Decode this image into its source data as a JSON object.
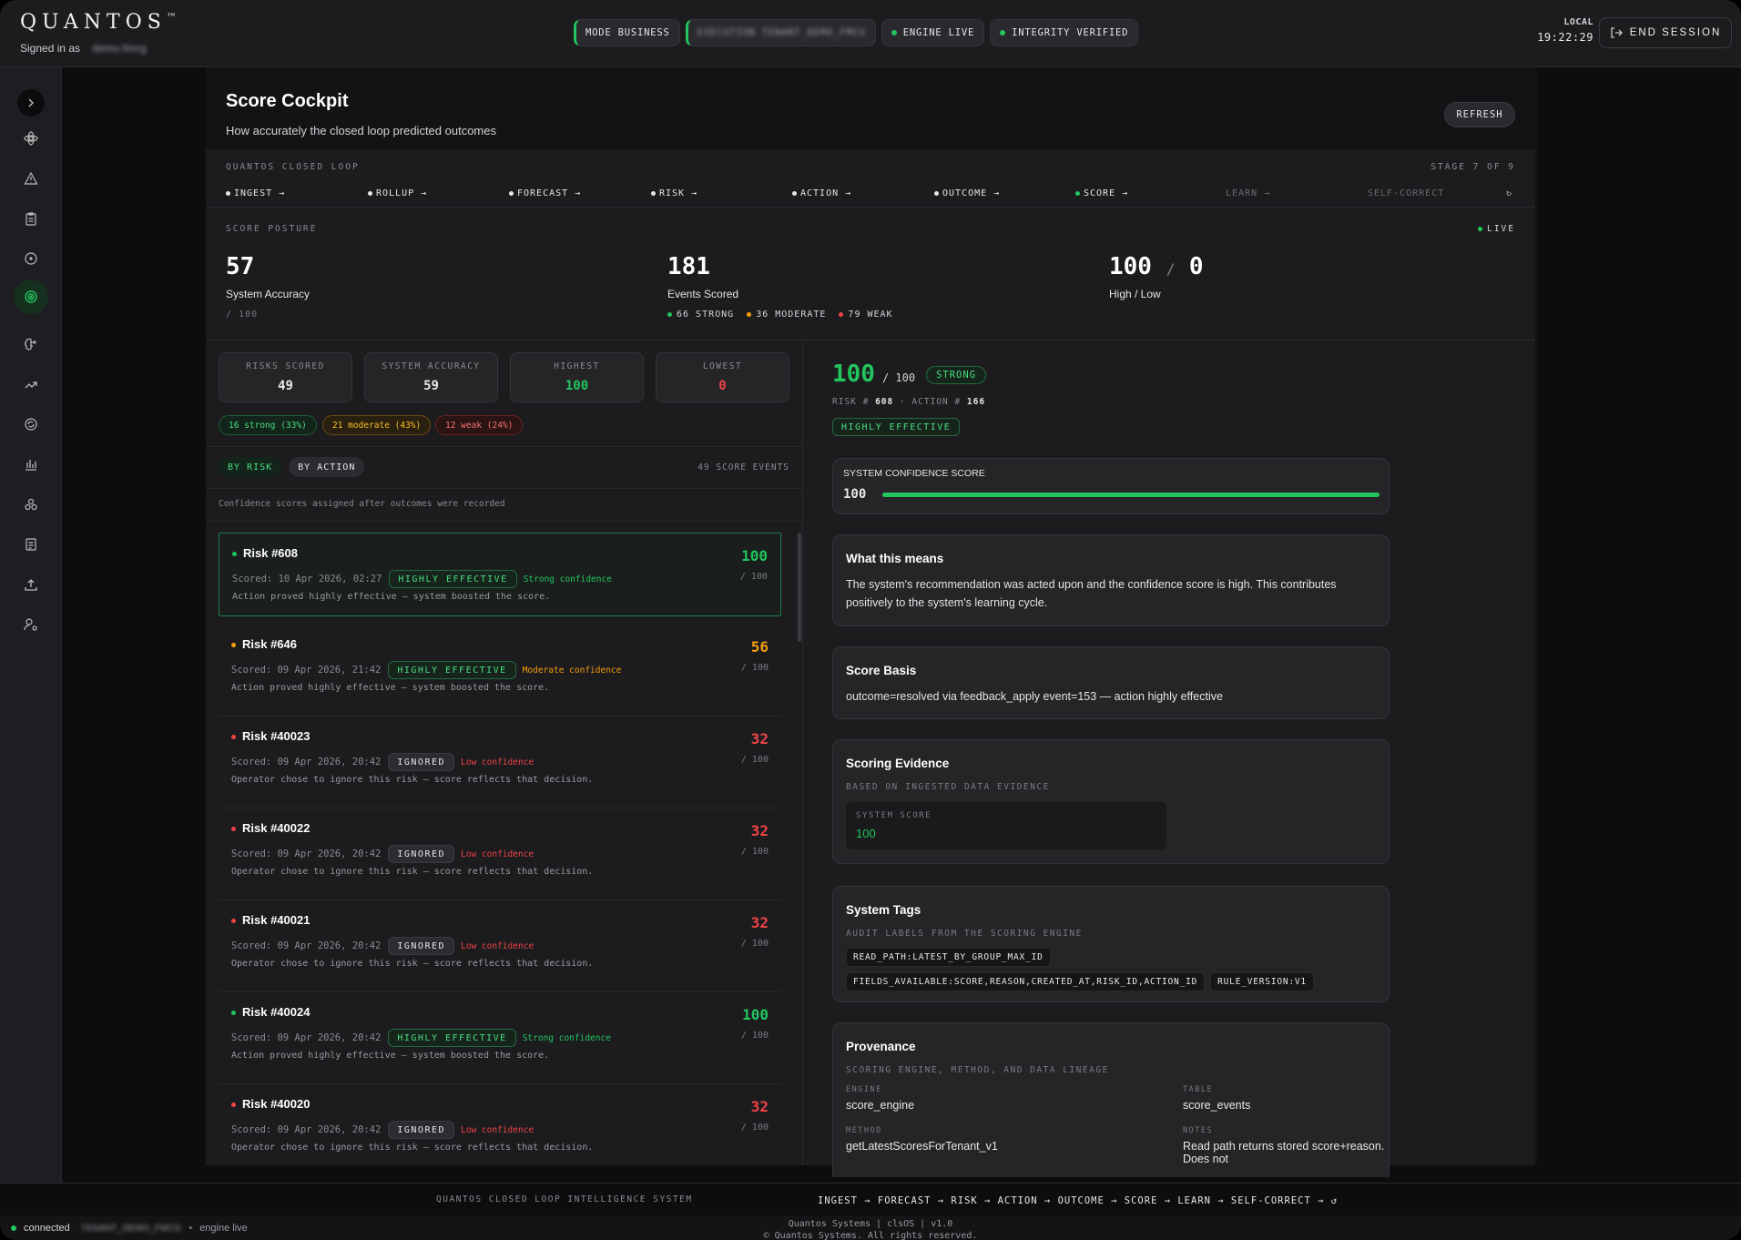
{
  "brand": {
    "name": "QUANTOS",
    "tm": "™",
    "signed_in_label": "Signed in as",
    "user": "demo.fmcg"
  },
  "status_pills": {
    "mode": "MODE BUSINESS",
    "execution": "EXECUTION TENANT_DEMO_FMCG",
    "engine": "ENGINE LIVE",
    "integrity": "INTEGRITY VERIFIED"
  },
  "clock": {
    "label": "LOCAL",
    "time": "19:22:29"
  },
  "end_session": "END SESSION",
  "page": {
    "title": "Score Cockpit",
    "subtitle": "How accurately the closed loop predicted outcomes",
    "refresh": "REFRESH"
  },
  "loop": {
    "label": "QUANTOS CLOSED LOOP",
    "stage_count": "STAGE 7 OF 9",
    "stages": [
      "INGEST →",
      "ROLLUP →",
      "FORECAST →",
      "RISK →",
      "ACTION →",
      "OUTCOME →",
      "SCORE →",
      "LEARN →",
      "SELF-CORRECT"
    ],
    "cycle": "↻"
  },
  "posture": {
    "label": "SCORE POSTURE",
    "live": "LIVE",
    "accuracy": {
      "value": "57",
      "caption": "System Accuracy",
      "sub": "/ 100"
    },
    "events": {
      "value": "181",
      "caption": "Events Scored",
      "strong": "66 STRONG",
      "moderate": "36 MODERATE",
      "weak": "79 WEAK"
    },
    "highlow": {
      "high": "100",
      "sep": "/",
      "low": "0",
      "caption": "High / Low"
    }
  },
  "stats": {
    "risks_label": "RISKS SCORED",
    "risks": "49",
    "acc_label": "SYSTEM ACCURACY",
    "acc": "59",
    "high_label": "HIGHEST",
    "high": "100",
    "low_label": "LOWEST",
    "low": "0"
  },
  "chips": {
    "strong": "16 strong (33%)",
    "moderate": "21 moderate (43%)",
    "weak": "12 weak (24%)"
  },
  "tabs": {
    "by_risk": "BY RISK",
    "by_action": "BY ACTION",
    "count": "49 SCORE EVENTS"
  },
  "list_note": "Confidence scores assigned after outcomes were recorded",
  "events": [
    {
      "title": "Risk #608",
      "scored": "Scored: 10 Apr 2026, 02:27",
      "badge": "HIGHLY EFFECTIVE",
      "conf": "Strong confidence",
      "note": "Action proved highly effective — system boosted the score.",
      "score": "100",
      "of": "/ 100"
    },
    {
      "title": "Risk #646",
      "scored": "Scored: 09 Apr 2026, 21:42",
      "badge": "HIGHLY EFFECTIVE",
      "conf": "Moderate confidence",
      "note": "Action proved highly effective — system boosted the score.",
      "score": "56",
      "of": "/ 100"
    },
    {
      "title": "Risk #40023",
      "scored": "Scored: 09 Apr 2026, 20:42",
      "badge": "IGNORED",
      "conf": "Low confidence",
      "note": "Operator chose to ignore this risk — score reflects that decision.",
      "score": "32",
      "of": "/ 100"
    },
    {
      "title": "Risk #40022",
      "scored": "Scored: 09 Apr 2026, 20:42",
      "badge": "IGNORED",
      "conf": "Low confidence",
      "note": "Operator chose to ignore this risk — score reflects that decision.",
      "score": "32",
      "of": "/ 100"
    },
    {
      "title": "Risk #40021",
      "scored": "Scored: 09 Apr 2026, 20:42",
      "badge": "IGNORED",
      "conf": "Low confidence",
      "note": "Operator chose to ignore this risk — score reflects that decision.",
      "score": "32",
      "of": "/ 100"
    },
    {
      "title": "Risk #40024",
      "scored": "Scored: 09 Apr 2026, 20:42",
      "badge": "HIGHLY EFFECTIVE",
      "conf": "Strong confidence",
      "note": "Action proved highly effective — system boosted the score.",
      "score": "100",
      "of": "/ 100"
    },
    {
      "title": "Risk #40020",
      "scored": "Scored: 09 Apr 2026, 20:42",
      "badge": "IGNORED",
      "conf": "Low confidence",
      "note": "Operator chose to ignore this risk — score reflects that decision.",
      "score": "32",
      "of": "/ 100"
    }
  ],
  "detail": {
    "score": "100",
    "of": "/ 100",
    "grade": "STRONG",
    "risk_label": "RISK #",
    "risk": "608",
    "action_label": "· ACTION #",
    "action": "166",
    "badge": "HIGHLY EFFECTIVE",
    "confidence_label": "SYSTEM CONFIDENCE SCORE",
    "confidence": "100",
    "confidence_fraction": 1.0,
    "meaning_title": "What this means",
    "meaning": "The system's recommendation was acted upon and the confidence score is high. This contributes positively to the system's learning cycle.",
    "basis_title": "Score Basis",
    "basis": "outcome=resolved via feedback_apply event=153 — action highly effective",
    "evidence_title": "Scoring Evidence",
    "evidence_sub": "BASED ON INGESTED DATA EVIDENCE",
    "sys_score_label": "SYSTEM SCORE",
    "sys_score": "100",
    "tags_title": "System Tags",
    "tags_sub": "AUDIT LABELS FROM THE SCORING ENGINE",
    "tags": [
      "READ_PATH:LATEST_BY_GROUP_MAX_ID",
      "FIELDS_AVAILABLE:SCORE,REASON,CREATED_AT,RISK_ID,ACTION_ID",
      "RULE_VERSION:V1"
    ],
    "prov_title": "Provenance",
    "prov_sub": "SCORING ENGINE, METHOD, AND DATA LINEAGE",
    "engine_label": "ENGINE",
    "engine": "score_engine",
    "table_label": "TABLE",
    "table": "score_events",
    "method_label": "METHOD",
    "method": "getLatestScoresForTenant_v1",
    "notes_label": "NOTES",
    "notes": "Read path returns stored score+reason. Does not"
  },
  "footer": {
    "system": "QUANTOS CLOSED LOOP INTELLIGENCE SYSTEM",
    "flow": "INGEST → FORECAST → RISK → ACTION → OUTCOME → SCORE → LEARN → SELF-CORRECT → ↺",
    "connected": "connected",
    "tenant": "TENANT_DEMO_FMCG",
    "engine": "engine live",
    "company": "Quantos Systems | clsOS | v1.0",
    "rights": "© Quantos Systems. All rights reserved."
  },
  "colors": {
    "green": "#22c55e",
    "amber": "#f59e0b",
    "red": "#ef4444"
  }
}
